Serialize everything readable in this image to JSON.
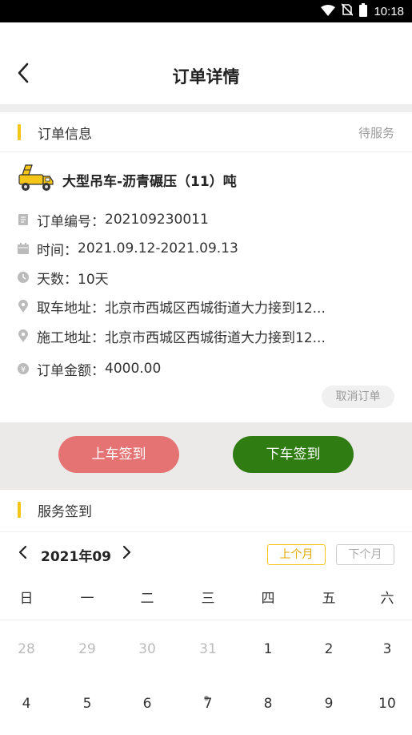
{
  "status_bar": {
    "time": "10:18"
  },
  "header": {
    "title": "订单详情"
  },
  "order_section": {
    "title": "订单信息",
    "status": "待服务",
    "order_name": "大型吊车-沥青碾压（11）吨",
    "rows": [
      {
        "label": "订单编号：",
        "value": "202109230011",
        "icon": "document-icon"
      },
      {
        "label": "时间：",
        "value": "2021.09.12-2021.09.13",
        "icon": "calendar-icon"
      },
      {
        "label": "天数：",
        "value": "10天",
        "icon": "clock-icon"
      },
      {
        "label": "取车地址：",
        "value": "北京市西城区西城街道大力接到12...",
        "icon": "location-icon"
      },
      {
        "label": "施工地址：",
        "value": "北京市西城区西城街道大力接到12...",
        "icon": "location-icon"
      },
      {
        "label": "订单金额：",
        "value": "4000.00",
        "icon": "yen-icon"
      }
    ],
    "cancel_label": "取消订单"
  },
  "actions": {
    "check_in_label": "上车签到",
    "check_out_label": "下车签到",
    "check_in_color": "#e57373",
    "check_out_color": "#2f7d12"
  },
  "service_section": {
    "title": "服务签到"
  },
  "calendar": {
    "month": "2021年09",
    "prev_month_label": "上个月",
    "next_month_label": "下个月",
    "weekdays": [
      "日",
      "一",
      "二",
      "三",
      "四",
      "五",
      "六"
    ],
    "week1": [
      "28",
      "29",
      "30",
      "31",
      "1",
      "2",
      "3"
    ],
    "week2": [
      "4",
      "5",
      "6",
      "7",
      "8",
      "9",
      "10"
    ]
  },
  "colors": {
    "accent": "#f5c518",
    "muted": "#999999"
  }
}
